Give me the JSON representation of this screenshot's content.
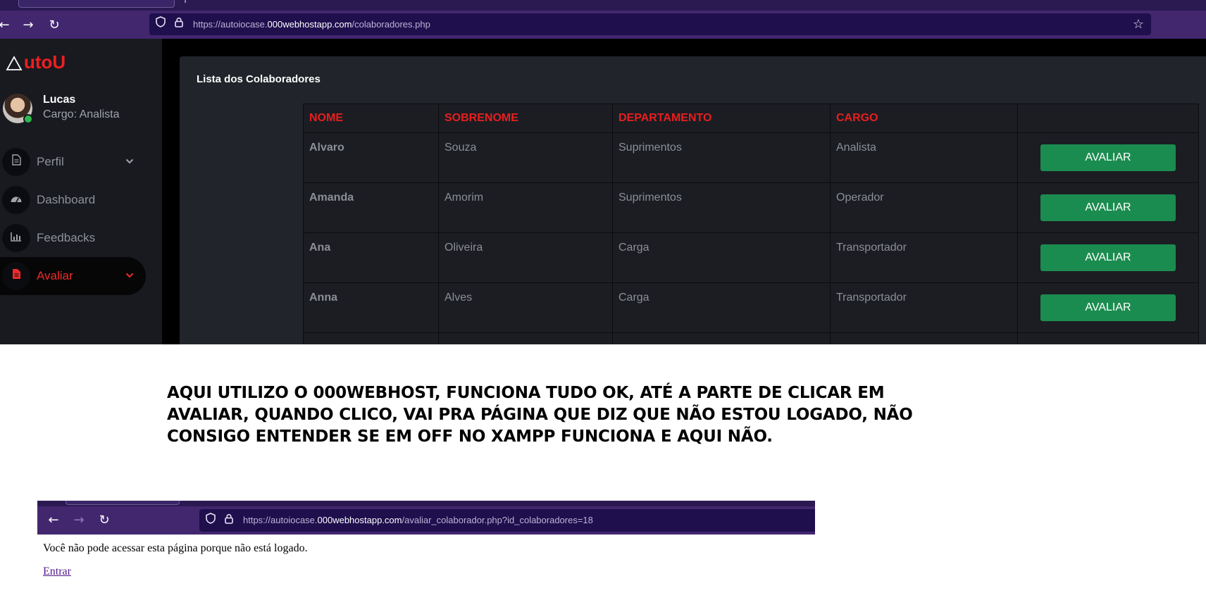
{
  "top_browser": {
    "url_prefix": "https://autoiocase.",
    "url_host": "000webhostapp.com",
    "url_path": "/colaboradores.php"
  },
  "app": {
    "logo_text": "utoU",
    "user": {
      "name": "Lucas",
      "role": "Cargo: Analista"
    },
    "menu": [
      {
        "label": "Perfil",
        "icon": "file-icon"
      },
      {
        "label": "Dashboard",
        "icon": "gauge-icon"
      },
      {
        "label": "Feedbacks",
        "icon": "bar-chart-icon"
      },
      {
        "label": "Avaliar",
        "icon": "file-icon"
      }
    ],
    "panel_title": "Lista dos Colaboradores",
    "table": {
      "headers": [
        "NOME",
        "SOBRENOME",
        "DEPARTAMENTO",
        "CARGO",
        ""
      ],
      "rows": [
        [
          "Alvaro",
          "Souza",
          "Suprimentos",
          "Analista"
        ],
        [
          "Amanda",
          "Amorim",
          "Suprimentos",
          "Operador"
        ],
        [
          "Ana",
          "Oliveira",
          "Carga",
          "Transportador"
        ],
        [
          "Anna",
          "Alves",
          "Carga",
          "Transportador"
        ]
      ],
      "action_label": "AVALIAR"
    },
    "colors": {
      "accent": "#ef1f1f",
      "button": "#1b8c4f",
      "sidebar": "#181a20",
      "panel": "#21242a"
    }
  },
  "caption": "AQUI UTILIZO O 000WEBHOST, FUNCIONA TUDO OK, ATÉ A PARTE DE CLICAR EM AVALIAR, QUANDO CLICO, VAI PRA PÁGINA QUE DIZ QUE NÃO ESTOU LOGADO, NÃO CONSIGO ENTENDER SE EM OFF NO XAMPP FUNCIONA E AQUI NÃO.",
  "bottom_browser": {
    "url_prefix": "https://autoiocase.",
    "url_host": "000webhostapp.com",
    "url_path": "/avaliar_colaborador.php?id_colaboradores=18",
    "message": "Você não pode acessar esta página porque não está logado.",
    "link": "Entrar"
  }
}
